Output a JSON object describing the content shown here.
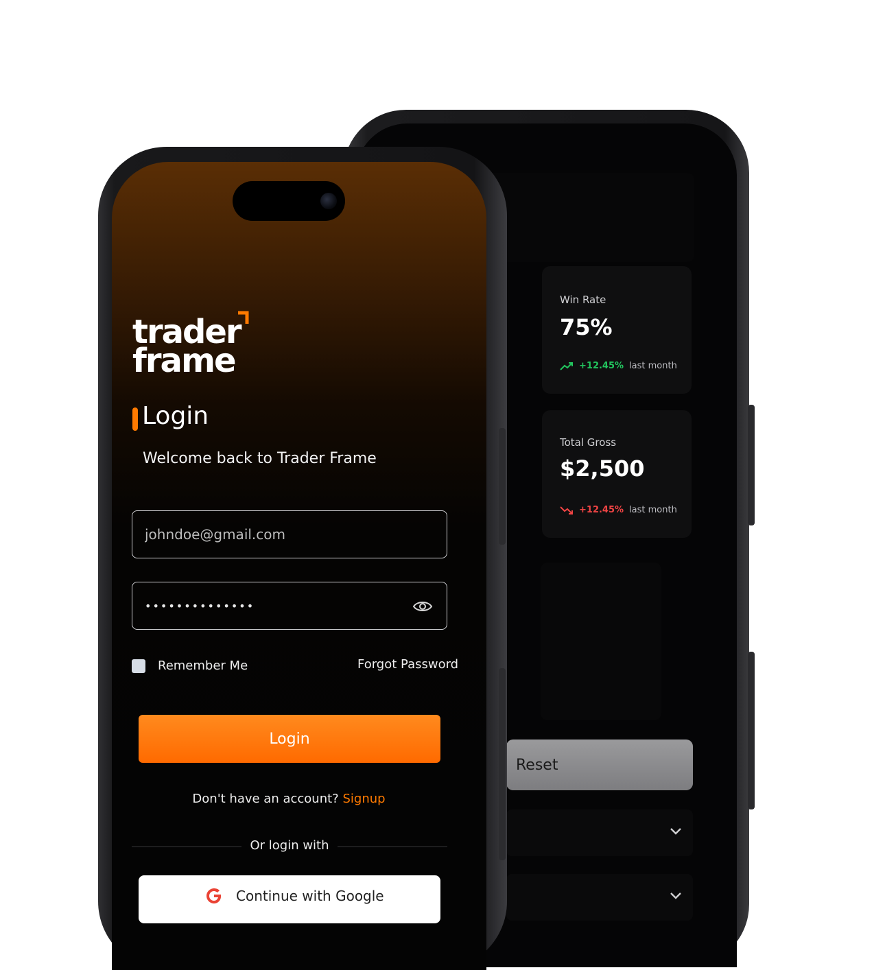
{
  "brand": {
    "logo_line1": "trader",
    "logo_line2": "frame",
    "accent_color": "#ff7a00"
  },
  "login": {
    "title": "Login",
    "subtitle": "Welcome back to Trader Frame",
    "email_placeholder": "johndoe@gmail.com",
    "password_value": "••••••••••••••",
    "remember_label": "Remember Me",
    "forgot_label": "Forgot Password",
    "login_button": "Login",
    "signup_prompt": "Don't have an account?",
    "signup_link": "Signup",
    "or_text": "Or login with",
    "google_button": "Continue with Google"
  },
  "dashboard": {
    "win_rate": {
      "label": "Win Rate",
      "value": "75%",
      "change": "+12.45%",
      "period": "last month",
      "trend_color": "#22c55e"
    },
    "total_gross": {
      "label": "Total Gross",
      "value": "$2,500",
      "change": "+12.45%",
      "period": "last month",
      "trend_color": "#ef4444"
    },
    "reset_button": "Reset"
  },
  "icons": {
    "password_toggle": "eye-icon",
    "trend_up": "trend-up-icon",
    "trend_down": "trend-down-icon",
    "dropdown": "chevron-down-icon",
    "google": "google-icon"
  }
}
